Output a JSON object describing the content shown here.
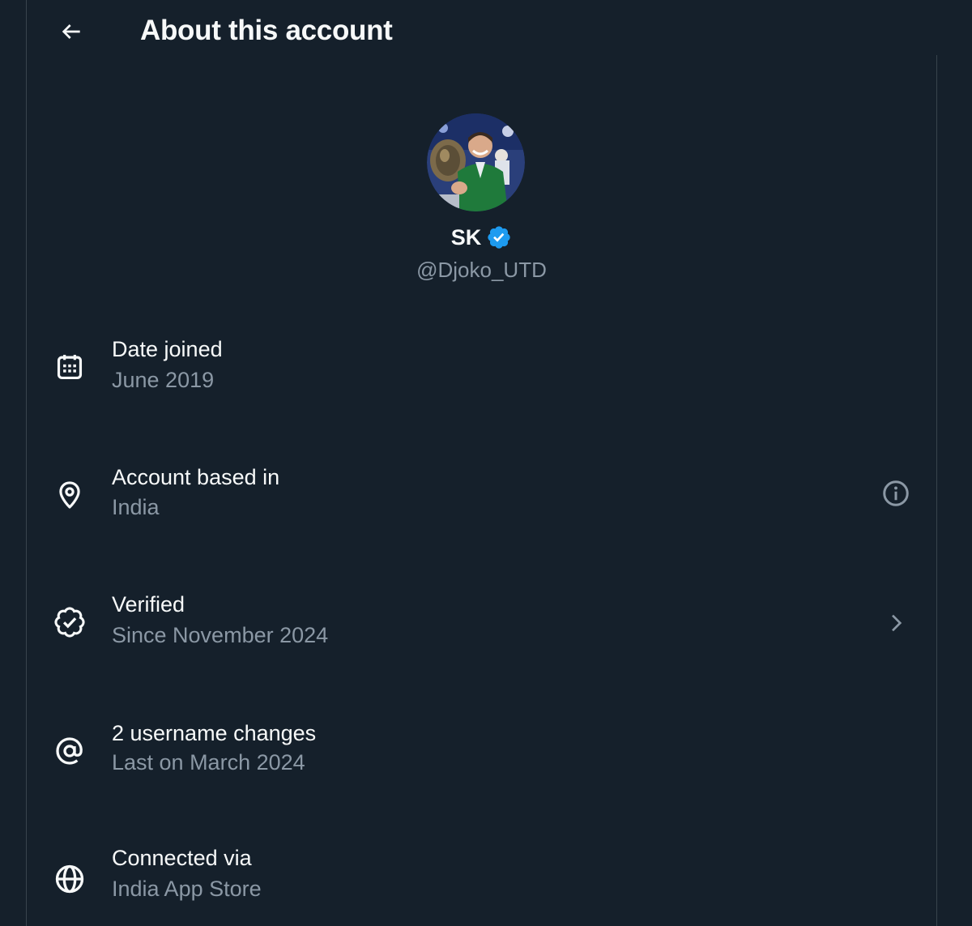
{
  "header": {
    "back_icon": "arrow-left-icon",
    "title": "About this account"
  },
  "profile": {
    "avatar_icon": "profile-photo",
    "display_name": "SK",
    "verified_icon": "verified-badge-icon",
    "verified_color": "#1d9bf0",
    "handle": "@Djoko_UTD"
  },
  "items": [
    {
      "icon": "calendar-icon",
      "title": "Date joined",
      "subtitle": "June 2019",
      "right_icon": ""
    },
    {
      "icon": "location-pin-icon",
      "title": "Account based in",
      "subtitle": "India",
      "right_icon": "info-icon"
    },
    {
      "icon": "verified-outline-icon",
      "title": "Verified",
      "subtitle": "Since November 2024",
      "right_icon": "chevron-right-icon"
    },
    {
      "icon": "at-sign-icon",
      "title": "2 username changes",
      "subtitle": "Last on March 2024",
      "right_icon": ""
    },
    {
      "icon": "globe-icon",
      "title": "Connected via",
      "subtitle": "India App Store",
      "right_icon": ""
    }
  ],
  "colors": {
    "background": "#15202b",
    "primary_text": "#f7f9f9",
    "secondary_text": "#8b98a5",
    "border": "#38444d"
  }
}
